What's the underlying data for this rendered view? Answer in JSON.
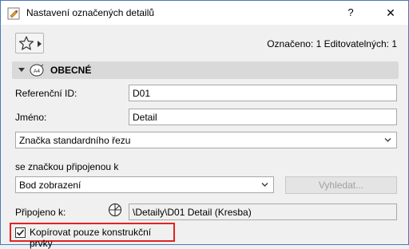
{
  "window": {
    "title": "Nastavení označených detailů",
    "help_label": "?",
    "close_label": "✕"
  },
  "toolbar": {
    "favorites_icon": "star-icon",
    "marked_text": "Označeno: 1 Editovatelných: 1"
  },
  "section": {
    "title": "OBECNÉ",
    "icon": "detail-marker-icon"
  },
  "fields": {
    "reference_id": {
      "label": "Referenční ID:",
      "value": "D01"
    },
    "name": {
      "label": "Jméno:",
      "value": "Detail"
    },
    "marker_type": {
      "value": "Značka standardního řezu"
    },
    "linked_marker": {
      "label": "se značkou připojenou k",
      "value": "Bod zobrazení"
    },
    "find_button": {
      "label": "Vyhledat..."
    },
    "linked_to": {
      "label": "Připojeno k:",
      "value": "\\Detaily\\D01 Detail (Kresba)"
    }
  },
  "options": {
    "copy_construction": {
      "label": "Kopírovat pouze konstrukční prvky",
      "checked": true
    }
  },
  "colors": {
    "highlight": "#e32222",
    "section_bg": "#d9d9d9"
  }
}
